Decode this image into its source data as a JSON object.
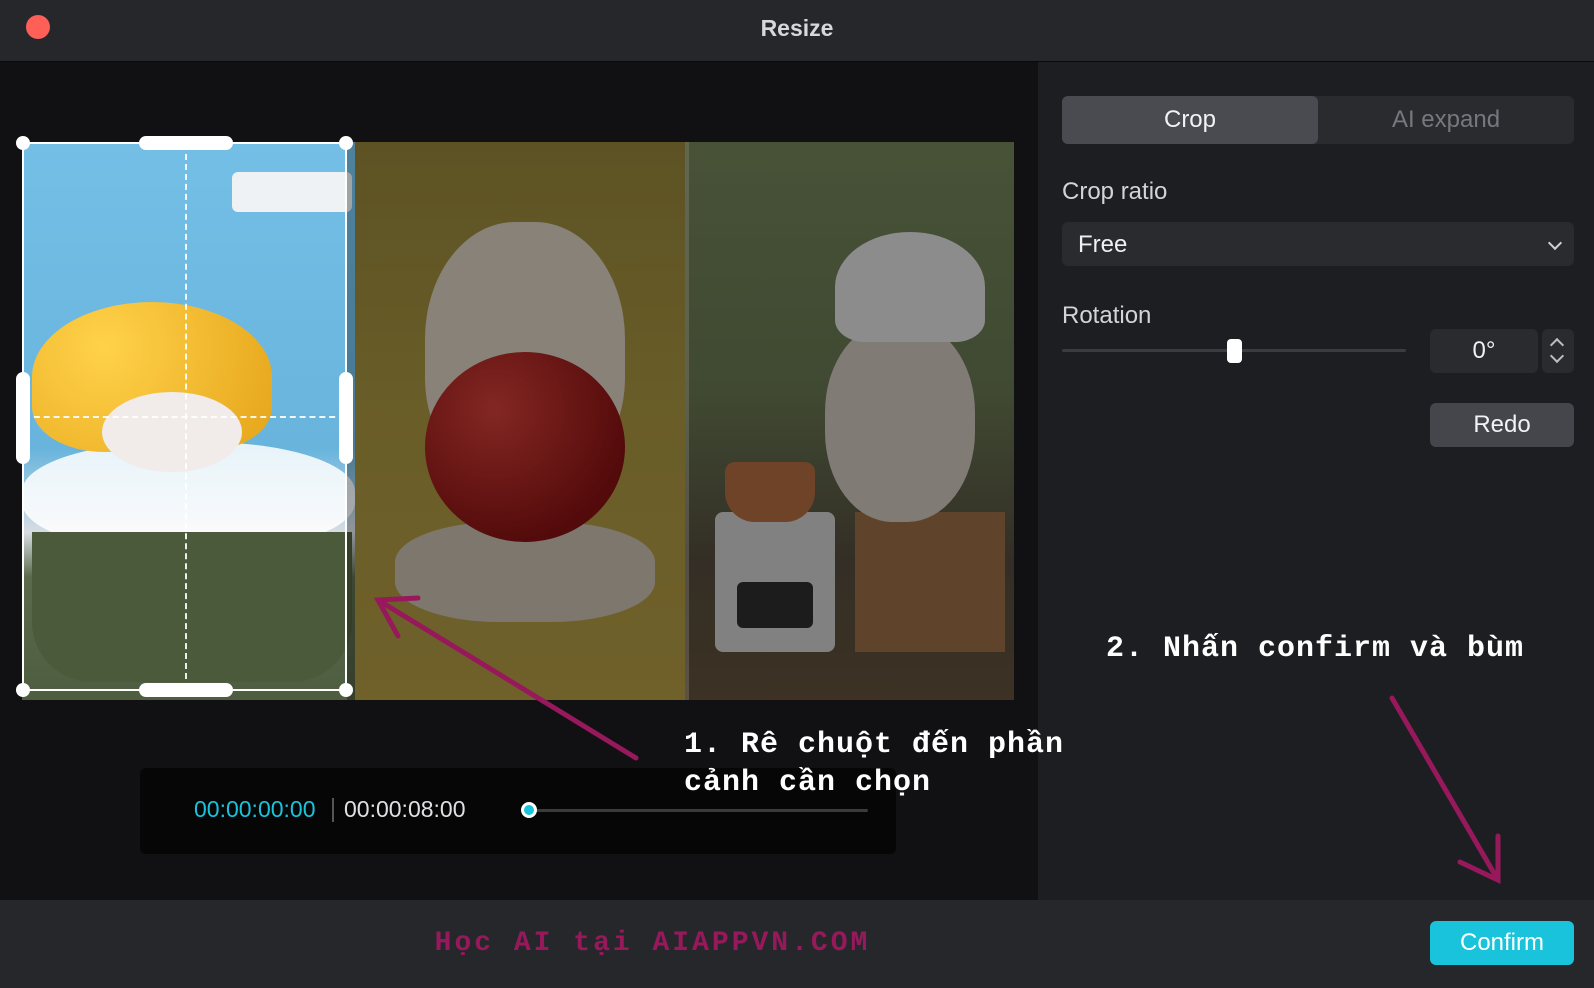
{
  "window": {
    "title": "Resize"
  },
  "preview": {
    "timeline": {
      "current_time": "00:00:00:00",
      "total_time": "00:00:08:00",
      "progress": 0
    }
  },
  "sidepanel": {
    "tabs": [
      {
        "label": "Crop",
        "active": true
      },
      {
        "label": "AI expand",
        "active": false
      }
    ],
    "crop_ratio": {
      "label": "Crop ratio",
      "value": "Free"
    },
    "rotation": {
      "label": "Rotation",
      "value": "0°",
      "slider_fraction": 0.5
    },
    "redo_label": "Redo"
  },
  "footer": {
    "watermark": "Học AI tại AIAPPVN.COM",
    "confirm_label": "Confirm"
  },
  "annotations": {
    "step1_line1": "1. Rê chuột đến phần",
    "step1_line2": "cảnh cần chọn",
    "step2": "2. Nhấn confirm và bùm",
    "color": "#97195c"
  },
  "colors": {
    "accent": "#19c3db",
    "close": "#fe5f57",
    "background": "#101012"
  }
}
